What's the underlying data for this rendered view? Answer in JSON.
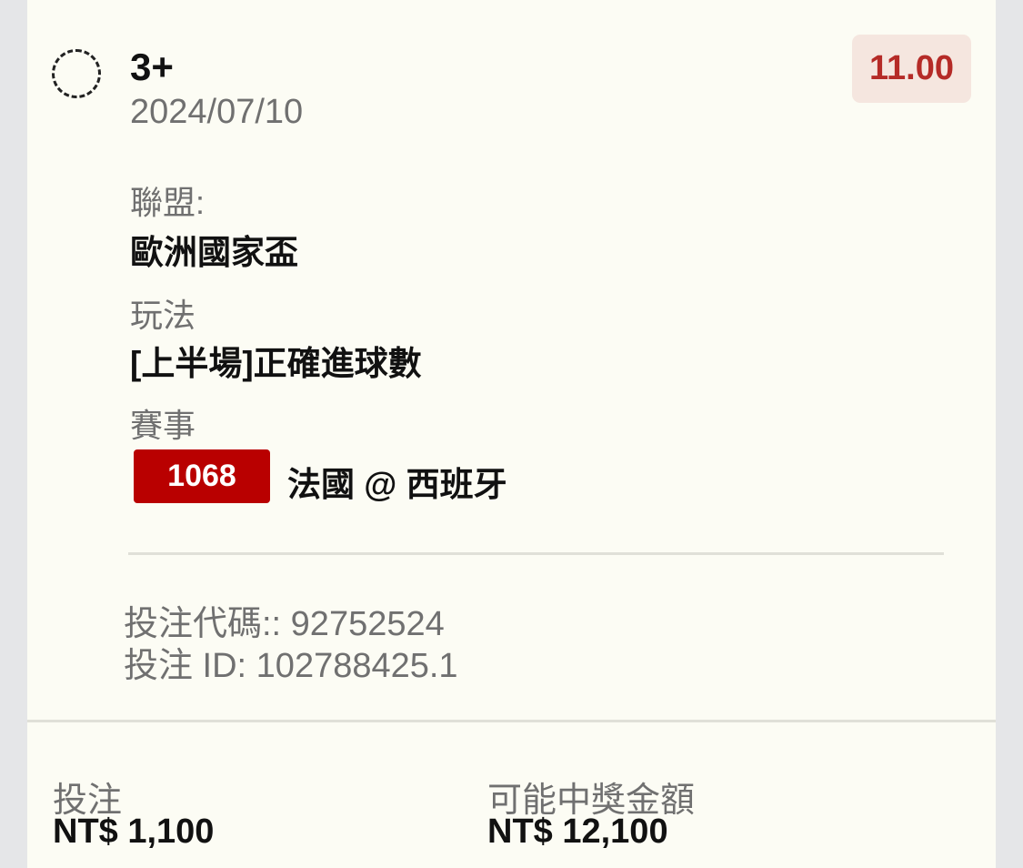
{
  "bet": {
    "selection": "3+",
    "date": "2024/07/10",
    "odds": "11.00"
  },
  "fields": {
    "league_label": "聯盟:",
    "league_value": "歐洲國家盃",
    "market_label": "玩法",
    "market_value": "[上半場]正確進球數",
    "event_label": "賽事",
    "event_code": "1068",
    "event_match": "法國 @ 西班牙"
  },
  "meta": {
    "bet_code": "投注代碼:: 92752524",
    "bet_id": "投注 ID: 102788425.1"
  },
  "footer": {
    "stake_label": "投注",
    "stake_value": "NT$ 1,100",
    "payout_label": "可能中獎金額",
    "payout_value": "NT$ 12,100"
  }
}
